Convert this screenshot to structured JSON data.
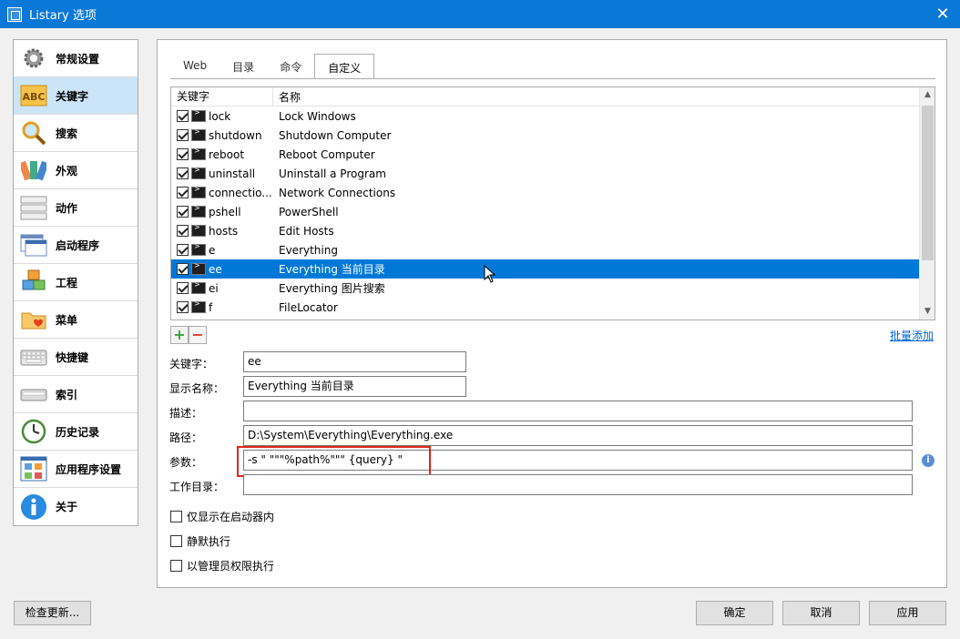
{
  "window": {
    "title": "Listary 选项"
  },
  "sidebar": {
    "items": [
      {
        "label": "常规设置",
        "icon": "gear-icon"
      },
      {
        "label": "关键字",
        "icon": "abc-icon",
        "active": true
      },
      {
        "label": "搜索",
        "icon": "magnifier-icon"
      },
      {
        "label": "外观",
        "icon": "palette-icon"
      },
      {
        "label": "动作",
        "icon": "action-list-icon"
      },
      {
        "label": "启动程序",
        "icon": "launcher-icon"
      },
      {
        "label": "工程",
        "icon": "boxes-icon"
      },
      {
        "label": "菜单",
        "icon": "folder-heart-icon"
      },
      {
        "label": "快捷键",
        "icon": "keyboard-icon"
      },
      {
        "label": "索引",
        "icon": "index-icon"
      },
      {
        "label": "历史记录",
        "icon": "clock-icon"
      },
      {
        "label": "应用程序设置",
        "icon": "app-settings-icon"
      },
      {
        "label": "关于",
        "icon": "info-icon"
      }
    ]
  },
  "tabs": [
    {
      "label": "Web"
    },
    {
      "label": "目录"
    },
    {
      "label": "命令"
    },
    {
      "label": "自定义",
      "active": true
    }
  ],
  "list": {
    "headers": {
      "keyword": "关键字",
      "name": "名称"
    },
    "rows": [
      {
        "keyword": "lock",
        "name": "Lock Windows",
        "checked": true
      },
      {
        "keyword": "shutdown",
        "name": "Shutdown Computer",
        "checked": true
      },
      {
        "keyword": "reboot",
        "name": "Reboot Computer",
        "checked": true
      },
      {
        "keyword": "uninstall",
        "name": "Uninstall a Program",
        "checked": true
      },
      {
        "keyword": "connectio...",
        "name": "Network Connections",
        "checked": true
      },
      {
        "keyword": "pshell",
        "name": "PowerShell",
        "checked": true
      },
      {
        "keyword": "hosts",
        "name": "Edit Hosts",
        "checked": true
      },
      {
        "keyword": "e",
        "name": "Everything",
        "checked": true
      },
      {
        "keyword": "ee",
        "name": "Everything 当前目录",
        "checked": true,
        "selected": true
      },
      {
        "keyword": "ei",
        "name": "Everything 图片搜索",
        "checked": true
      },
      {
        "keyword": "f",
        "name": "FileLocator",
        "checked": true
      }
    ]
  },
  "batch_add": "批量添加",
  "form": {
    "keyword_label": "关键字：",
    "keyword_value": "ee",
    "display_name_label": "显示名称：",
    "display_name_value": "Everything 当前目录",
    "desc_label": "描述：",
    "desc_value": "",
    "path_label": "路径：",
    "path_value": "D:\\System\\Everything\\Everything.exe",
    "params_label": "参数：",
    "params_value": "-s \" \"\"\"%path%\"\"\" {query} \"",
    "workdir_label": "工作目录：",
    "workdir_value": ""
  },
  "options": [
    {
      "label": "仅显示在启动器内",
      "checked": false
    },
    {
      "label": "静默执行",
      "checked": false
    },
    {
      "label": "以管理员权限执行",
      "checked": false
    }
  ],
  "buttons": {
    "check_update": "检查更新...",
    "ok": "确定",
    "cancel": "取消",
    "apply": "应用"
  },
  "colors": {
    "titlebar": "#0a78d7",
    "selection": "#0078d7",
    "highlight": "#e1251b",
    "link": "#0066cc"
  }
}
